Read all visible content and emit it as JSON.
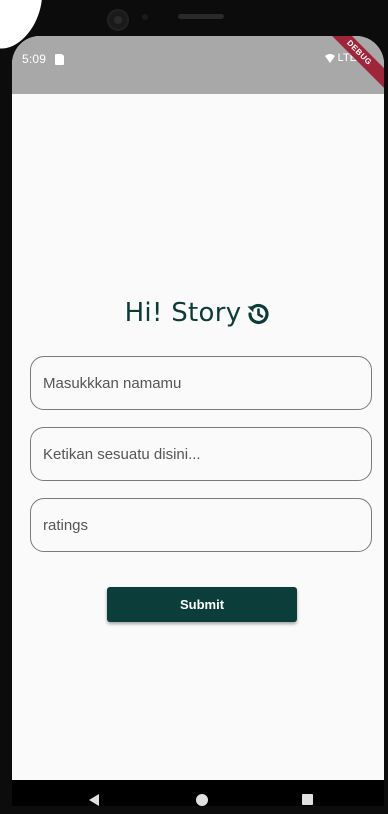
{
  "status_bar": {
    "time": "5:09",
    "network": "LTE",
    "debug_banner": "DEBUG"
  },
  "logo": {
    "text": "Hi! Story",
    "icon": "history-icon"
  },
  "form": {
    "name_placeholder": "Masukkkan namamu",
    "story_placeholder": "Ketikan sesuatu disini...",
    "rating_placeholder": "ratings",
    "submit_label": "Submit"
  },
  "nav": {
    "back_icon": "triangle-back-icon",
    "home_icon": "circle-home-icon",
    "recents_icon": "square-recents-icon"
  },
  "colors": {
    "brand": "#0b3d3a",
    "status_bar": "#a8a8a8",
    "debug": "#a0253a"
  }
}
